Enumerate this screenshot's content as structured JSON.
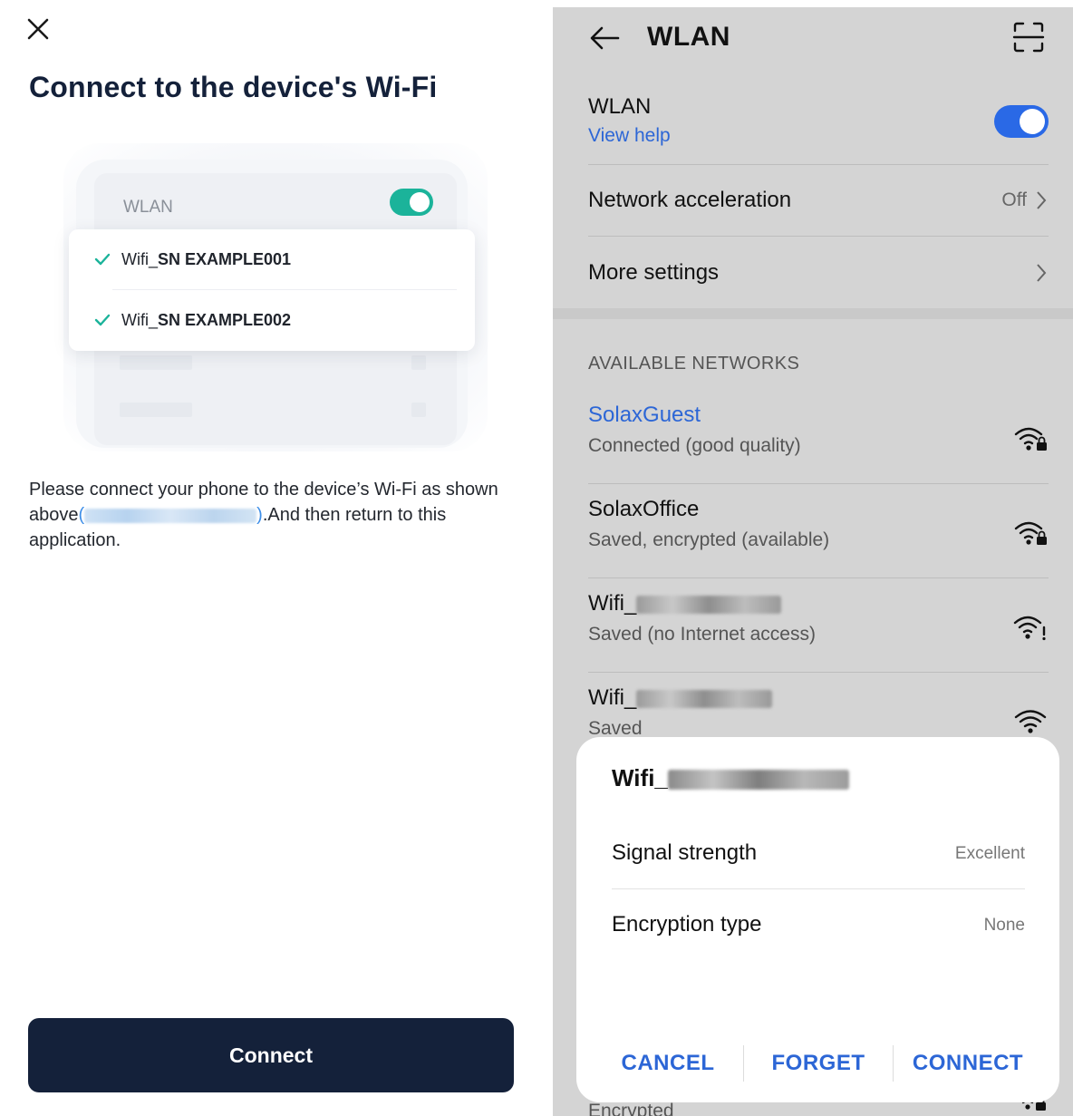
{
  "left": {
    "title": "Connect to the device's Wi-Fi",
    "illustration": {
      "wlan_label": "WLAN",
      "networks": [
        {
          "prefix": "Wifi_",
          "bold": "SN EXAMPLE001"
        },
        {
          "prefix": "Wifi_",
          "bold": "SN EXAMPLE002"
        }
      ]
    },
    "description": {
      "part1": "Please connect your phone to the device’s Wi-Fi as shown above",
      "part2": ".And then return to this application."
    },
    "connect_button": "Connect"
  },
  "right": {
    "title": "WLAN",
    "wlan": {
      "label": "WLAN",
      "help": "View help",
      "enabled": true
    },
    "network_acceleration": {
      "label": "Network acceleration",
      "value": "Off"
    },
    "more_settings": "More settings",
    "available_header": "AVAILABLE NETWORKS",
    "networks": [
      {
        "name": "SolaxGuest",
        "status": "Connected (good quality)",
        "icon": "wifi-lock-icon"
      },
      {
        "name": "SolaxOffice",
        "status": "Saved, encrypted (available)",
        "icon": "wifi-lock-icon"
      },
      {
        "name": "Wifi_",
        "status": "Saved (no Internet access)",
        "icon": "wifi-no-internet-icon"
      },
      {
        "name": "Wifi_",
        "status": "Saved",
        "icon": "wifi-icon"
      }
    ],
    "dialog": {
      "title_prefix": "Wifi_",
      "signal_label": "Signal strength",
      "signal_value": "Excellent",
      "encryption_label": "Encryption type",
      "encryption_value": "None",
      "cancel": "CANCEL",
      "forget": "FORGET",
      "connect": "CONNECT"
    },
    "peek_status": "Encrypted"
  },
  "colors": {
    "primary_dark": "#14213a",
    "toggle_green": "#1bb39a",
    "android_blue": "#2c66d6"
  }
}
